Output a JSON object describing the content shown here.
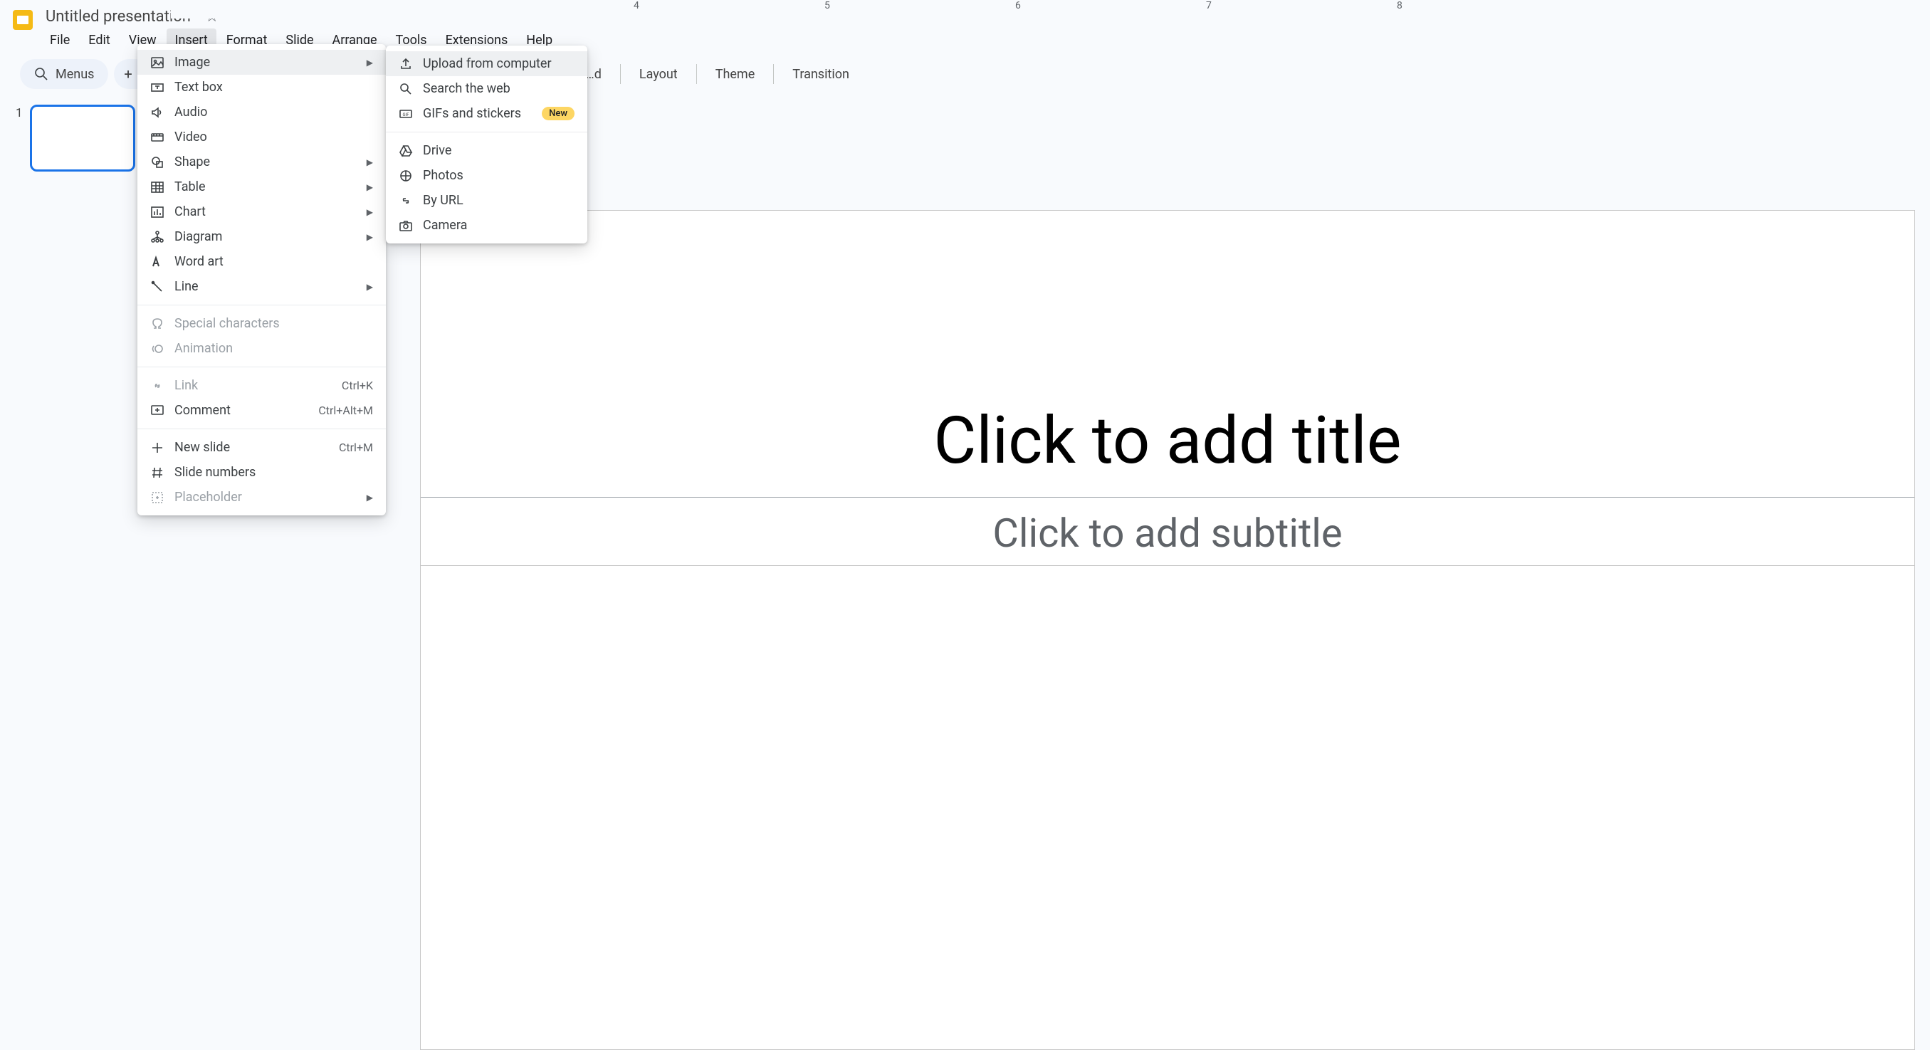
{
  "header": {
    "doc_title": "Untitled presentation",
    "menus": [
      "File",
      "Edit",
      "View",
      "Insert",
      "Format",
      "Slide",
      "Arrange",
      "Tools",
      "Extensions",
      "Help"
    ],
    "active_menu_index": 3
  },
  "toolbar": {
    "menus_label": "Menus",
    "background": "Background",
    "layout": "Layout",
    "theme": "Theme",
    "transition": "Transition"
  },
  "ruler_top": [
    "4",
    "5",
    "6",
    "7",
    "8"
  ],
  "thumbnails": {
    "first_index": "1"
  },
  "canvas": {
    "title_placeholder": "Click to add title",
    "subtitle_placeholder": "Click to add subtitle"
  },
  "insert_menu": {
    "items": [
      {
        "icon": "image",
        "label": "Image",
        "submenu": true,
        "hover": true
      },
      {
        "icon": "textbox",
        "label": "Text box"
      },
      {
        "icon": "audio",
        "label": "Audio"
      },
      {
        "icon": "video",
        "label": "Video"
      },
      {
        "icon": "shape",
        "label": "Shape",
        "submenu": true
      },
      {
        "icon": "table",
        "label": "Table",
        "submenu": true
      },
      {
        "icon": "chart",
        "label": "Chart",
        "submenu": true
      },
      {
        "icon": "diagram",
        "label": "Diagram",
        "submenu": true
      },
      {
        "icon": "wordart",
        "label": "Word art"
      },
      {
        "icon": "line",
        "label": "Line",
        "submenu": true
      },
      {
        "sep": true
      },
      {
        "icon": "omega",
        "label": "Special characters",
        "disabled": true
      },
      {
        "icon": "animation",
        "label": "Animation",
        "disabled": true
      },
      {
        "sep": true
      },
      {
        "icon": "link",
        "label": "Link",
        "shortcut": "Ctrl+K",
        "disabled": true
      },
      {
        "icon": "comment",
        "label": "Comment",
        "shortcut": "Ctrl+Alt+M"
      },
      {
        "sep": true
      },
      {
        "icon": "plus",
        "label": "New slide",
        "shortcut": "Ctrl+M"
      },
      {
        "icon": "hash",
        "label": "Slide numbers"
      },
      {
        "icon": "placeholder",
        "label": "Placeholder",
        "submenu": true,
        "disabled": true
      }
    ]
  },
  "image_submenu": {
    "items": [
      {
        "icon": "upload",
        "label": "Upload from computer",
        "hover": true
      },
      {
        "icon": "search",
        "label": "Search the web"
      },
      {
        "icon": "gif",
        "label": "GIFs and stickers",
        "badge": "New"
      },
      {
        "sep": true
      },
      {
        "icon": "drive",
        "label": "Drive"
      },
      {
        "icon": "photos",
        "label": "Photos"
      },
      {
        "icon": "url",
        "label": "By URL"
      },
      {
        "icon": "camera",
        "label": "Camera"
      }
    ]
  }
}
